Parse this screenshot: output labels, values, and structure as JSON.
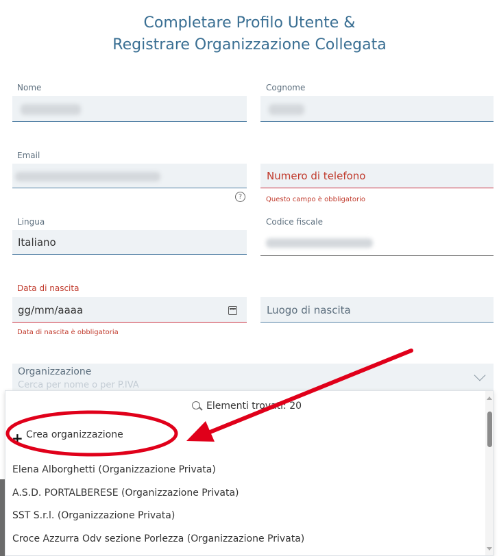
{
  "title": {
    "line1": "Completare Profilo Utente &",
    "line2": "Registrare Organizzazione Collegata"
  },
  "form": {
    "nome": {
      "label": "Nome",
      "value": ""
    },
    "cognome": {
      "label": "Cognome",
      "value": ""
    },
    "email": {
      "label": "Email",
      "value": ""
    },
    "telefono": {
      "placeholder": "Numero di telefono",
      "error": "Questo campo è obbligatorio"
    },
    "lingua": {
      "label": "Lingua",
      "value": "Italiano"
    },
    "codice_fiscale": {
      "label": "Codice fiscale",
      "value": ""
    },
    "data_nascita": {
      "label": "Data di nascita",
      "placeholder": "gg/mm/aaaa",
      "error": "Data di nascita è obbligatoria"
    },
    "luogo_nascita": {
      "placeholder": "Luogo di nascita"
    },
    "organizzazione": {
      "label": "Organizzazione",
      "placeholder": "Cerca per nome o per P.IVA"
    }
  },
  "dropdown": {
    "count_text": "Elementi trovati: 20",
    "create_label": "Crea organizzazione",
    "items": [
      "Elena Alborghetti (Organizzazione Privata)",
      "A.S.D. PORTALBERESE (Organizzazione Privata)",
      "SST S.r.l. (Organizzazione Privata)",
      "Croce Azzurra Odv sezione Porlezza (Organizzazione Privata)"
    ]
  },
  "icons": {
    "help": "question-circle-icon",
    "calendar": "calendar-icon",
    "chevron": "chevron-down-icon",
    "search": "search-icon",
    "plus": "plus-icon"
  },
  "colors": {
    "title": "#3a6f93",
    "error": "#c62b3c",
    "field_bg": "#eef2f5",
    "annotation": "#e0001a"
  }
}
